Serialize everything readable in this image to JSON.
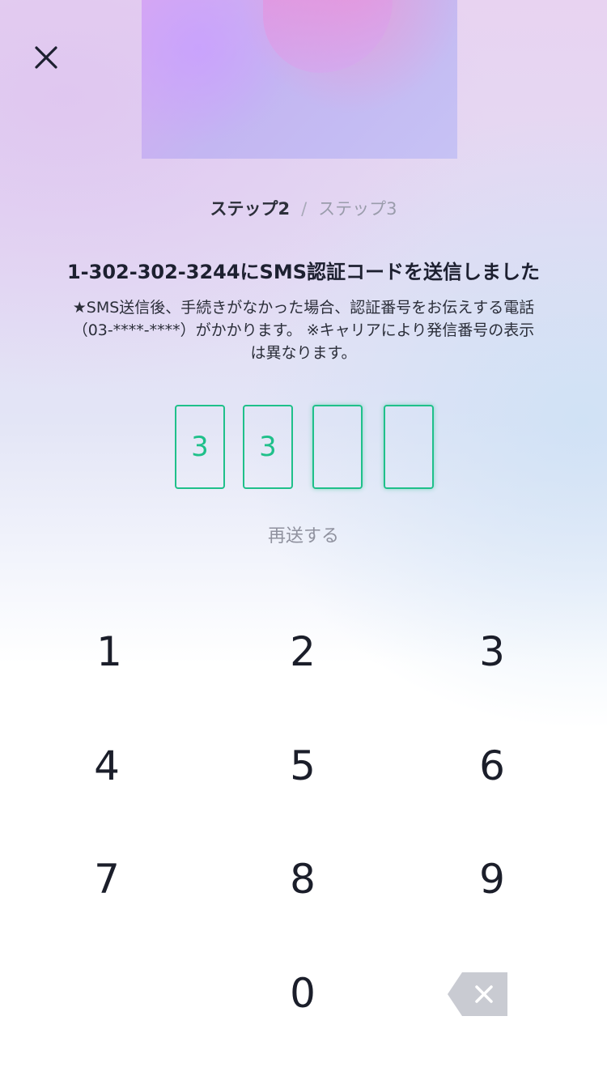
{
  "header": {
    "close_icon": "close-icon"
  },
  "steps": {
    "current": "ステップ2",
    "separator": "/",
    "next": "ステップ3"
  },
  "headline": "1-302-302-3244にSMS認証コードを送信しました",
  "note": "★SMS送信後、手続きがなかった場合、認証番号をお伝えする電話（03-****-****）がかかります。 ※キャリアにより発信番号の表示は異なります。",
  "code": {
    "digits": [
      "3",
      "3",
      "",
      ""
    ]
  },
  "resend_label": "再送する",
  "keypad": {
    "keys": [
      "1",
      "2",
      "3",
      "4",
      "5",
      "6",
      "7",
      "8",
      "9",
      "0"
    ],
    "backspace_icon": "backspace-icon"
  },
  "colors": {
    "accent": "#1fc08a",
    "text": "#1d2030",
    "muted": "#8f919e"
  }
}
